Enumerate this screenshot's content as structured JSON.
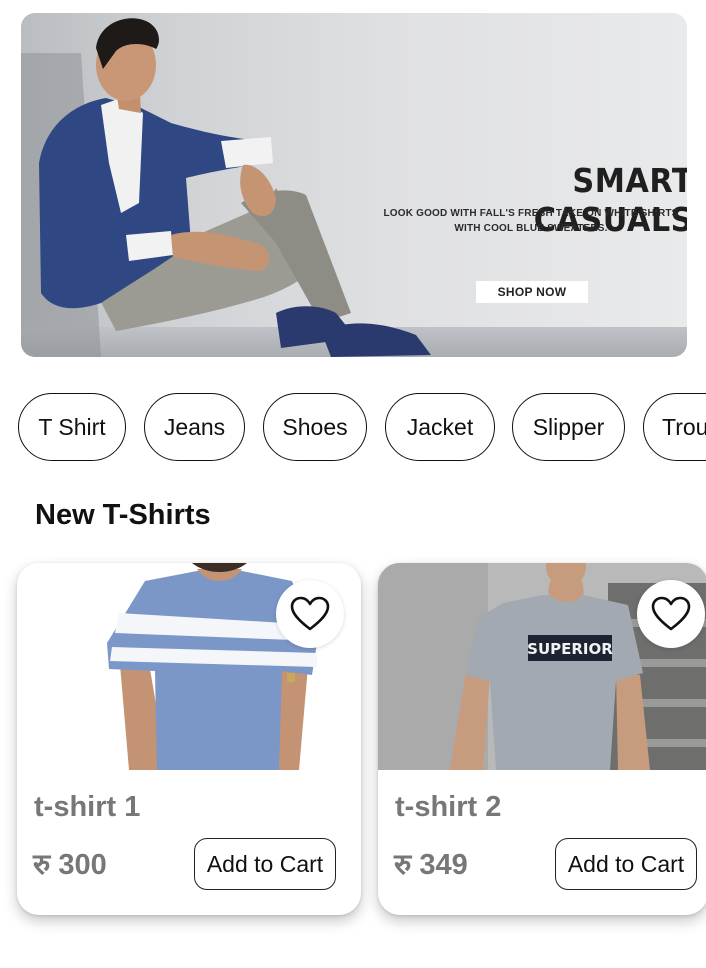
{
  "banner": {
    "title": "SMART CASUALS",
    "subtitle_line1": "LOOK GOOD WITH FALL'S FRESH TAKE ON WHITE SHIRTS",
    "subtitle_line2": "WITH COOL BLUE SWEATERS.",
    "button_label": "SHOP NOW"
  },
  "categories": [
    {
      "label": "T Shirt"
    },
    {
      "label": "Jeans"
    },
    {
      "label": "Shoes"
    },
    {
      "label": "Jacket"
    },
    {
      "label": "Slipper"
    },
    {
      "label": "Trou"
    }
  ],
  "section": {
    "title": "New T-Shirts"
  },
  "products": [
    {
      "name": "t-shirt 1",
      "price": "रु 300",
      "cart_label": "Add to Cart",
      "favorite_icon": "heart-outline-icon"
    },
    {
      "name": "t-shirt 2",
      "price": "रु 349",
      "cart_label": "Add to Cart",
      "favorite_icon": "heart-outline-icon"
    }
  ],
  "colors": {
    "accent_tshirt1": "#7b97c8",
    "tshirt2": "#a3a9b1"
  }
}
